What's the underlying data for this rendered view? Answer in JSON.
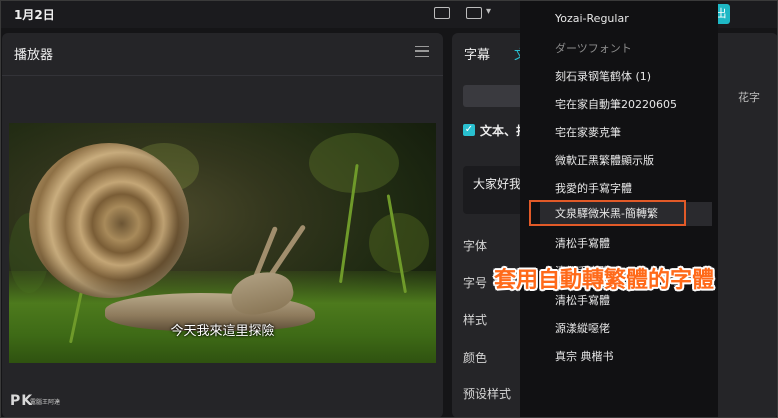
{
  "topbar": {
    "date": "1月2日",
    "export_glyph": "出"
  },
  "player": {
    "title": "播放器",
    "subtitle": "今天我來這里探險",
    "watermark_logo": "PK",
    "watermark_sub": "電腦王阿達"
  },
  "text_panel": {
    "tab_subtitle": "字幕",
    "tab_text": "文",
    "right_tab": "花字",
    "checkbox_label": "文本、排",
    "text_value": "大家好我",
    "props": [
      "字体",
      "字号",
      "样式",
      "颜色",
      "预设样式"
    ]
  },
  "font_dropdown": {
    "items": [
      {
        "label": "Yozai-Regular",
        "dim": false
      },
      {
        "label": "ダーツフォント",
        "dim": true
      },
      {
        "label": "刻石录钢笔鹤体 (1)",
        "dim": false
      },
      {
        "label": "宅在家自動筆20220605",
        "dim": false
      },
      {
        "label": "宅在家麥克筆",
        "dim": false
      },
      {
        "label": "微軟正黑繁體顯示版",
        "dim": false
      },
      {
        "label": "我愛的手寫字體",
        "dim": false
      },
      {
        "label": "文泉驛微米黑-簡轉繁",
        "dim": false,
        "selected": true
      },
      {
        "label": "清松手寫體",
        "dim": false
      },
      {
        "label": "清松手寫體",
        "dim": false
      },
      {
        "label": "清松手寫體",
        "dim": false
      },
      {
        "label": "源漾縱噁佬",
        "dim": false
      },
      {
        "label": "真宗 典楷书",
        "dim": false
      }
    ]
  },
  "annotation": "套用自動轉繁體的字體",
  "colors": {
    "accent": "#29c0d0",
    "highlight": "#e25a28",
    "annotation": "#ff6a1a"
  }
}
